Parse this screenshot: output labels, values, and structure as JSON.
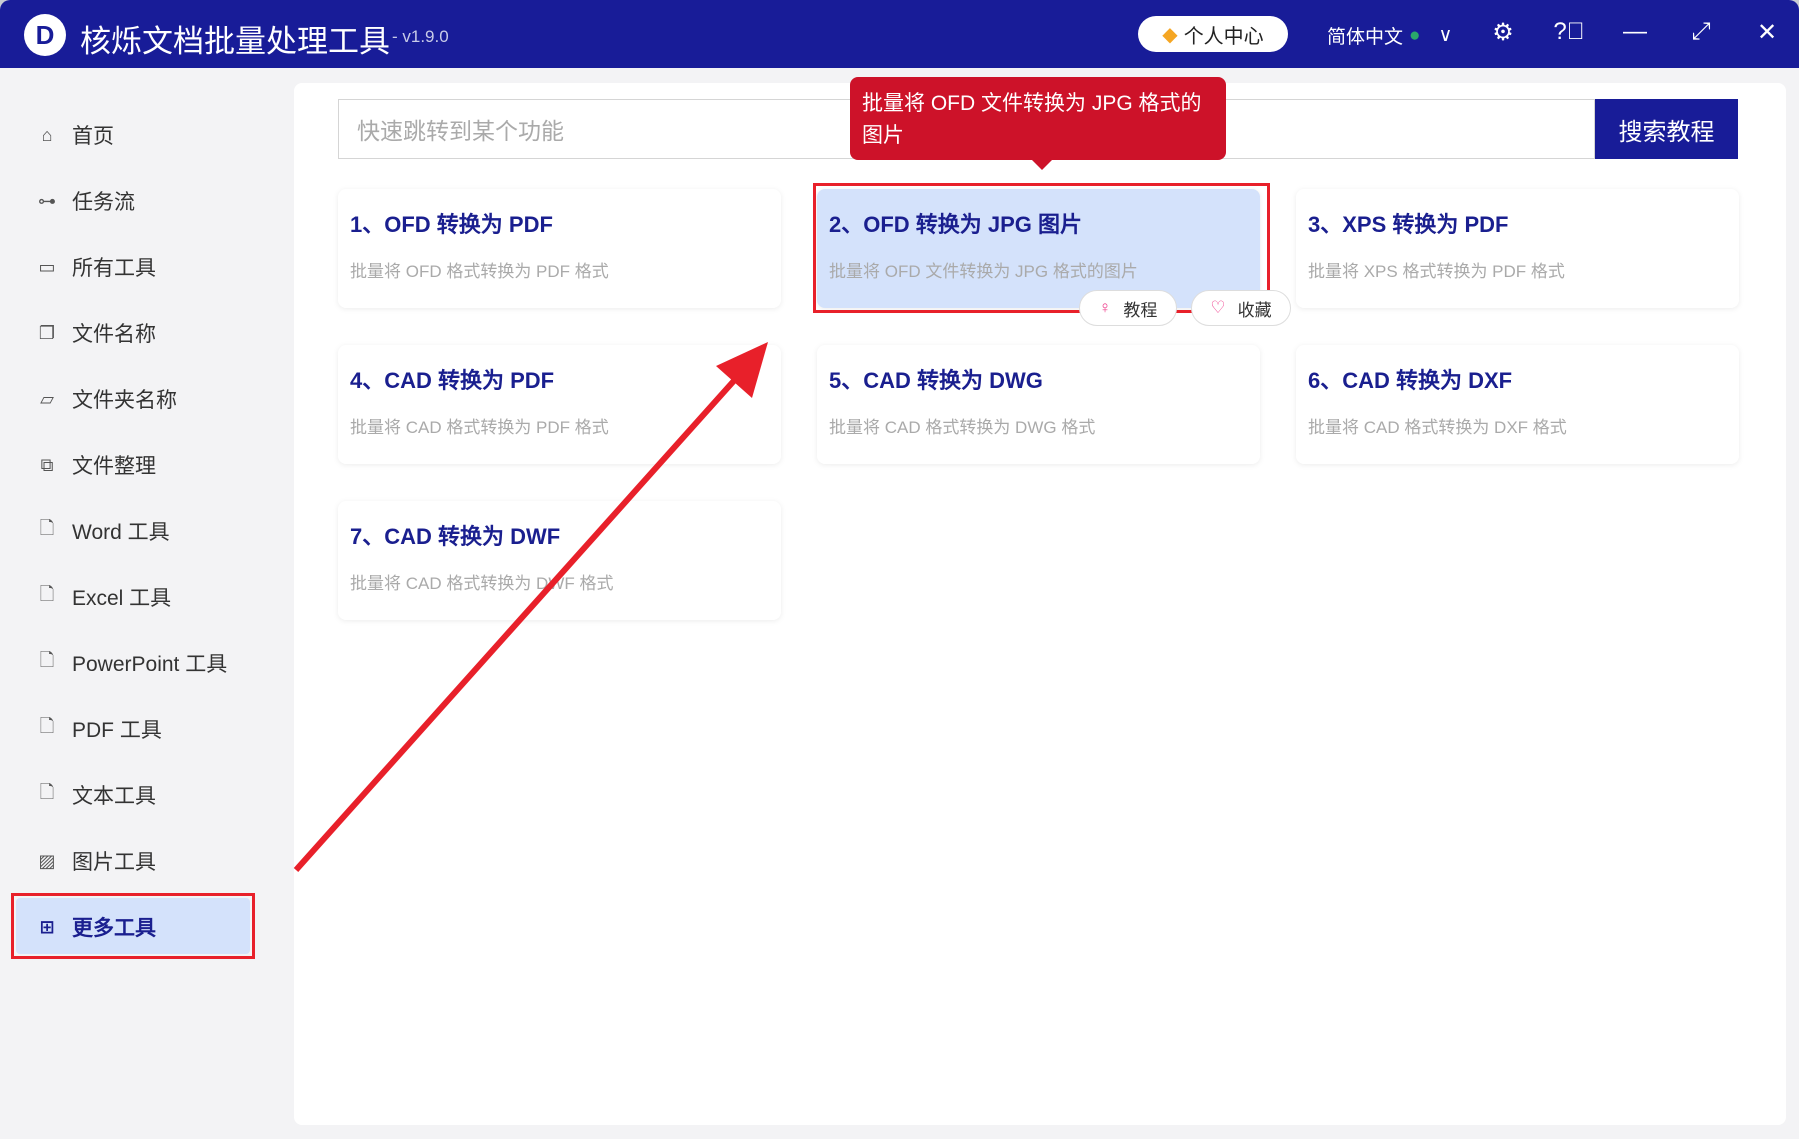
{
  "app": {
    "title": "核烁文档批量处理工具",
    "version": "- v1.9.0",
    "logo": "D"
  },
  "titlebar": {
    "personal_center": "个人中心",
    "language": "简体中文"
  },
  "sidebar": {
    "items": [
      {
        "label": "首页",
        "icon": "home-icon"
      },
      {
        "label": "任务流",
        "icon": "workflow-icon"
      },
      {
        "label": "所有工具",
        "icon": "monitor-icon"
      },
      {
        "label": "文件名称",
        "icon": "file-icon"
      },
      {
        "label": "文件夹名称",
        "icon": "folder-icon"
      },
      {
        "label": "文件整理",
        "icon": "organize-icon"
      },
      {
        "label": "Word 工具",
        "icon": "word-icon"
      },
      {
        "label": "Excel 工具",
        "icon": "excel-icon"
      },
      {
        "label": "PowerPoint 工具",
        "icon": "ppt-icon"
      },
      {
        "label": "PDF 工具",
        "icon": "pdf-icon"
      },
      {
        "label": "文本工具",
        "icon": "text-icon"
      },
      {
        "label": "图片工具",
        "icon": "image-icon"
      },
      {
        "label": "更多工具",
        "icon": "grid-icon",
        "active": true
      }
    ]
  },
  "search": {
    "placeholder": "快速跳转到某个功能",
    "button": "搜索教程"
  },
  "tooltip": "批量将 OFD 文件转换为 JPG 格式的图片",
  "cards": [
    {
      "title": "1、OFD 转换为 PDF",
      "desc": "批量将 OFD 格式转换为 PDF 格式"
    },
    {
      "title": "2、OFD 转换为 JPG 图片",
      "desc": "批量将 OFD 文件转换为 JPG 格式的图片"
    },
    {
      "title": "3、XPS 转换为 PDF",
      "desc": "批量将 XPS 格式转换为 PDF 格式"
    },
    {
      "title": "4、CAD 转换为 PDF",
      "desc": "批量将 CAD 格式转换为 PDF 格式"
    },
    {
      "title": "5、CAD 转换为 DWG",
      "desc": "批量将 CAD 格式转换为 DWG 格式"
    },
    {
      "title": "6、CAD 转换为 DXF",
      "desc": "批量将 CAD 格式转换为 DXF 格式"
    },
    {
      "title": "7、CAD 转换为 DWF",
      "desc": "批量将 CAD 格式转换为 DWF 格式"
    }
  ],
  "card_actions": {
    "tutorial": "教程",
    "favorite": "收藏"
  },
  "colors": {
    "brand": "#181c98",
    "highlight": "#e8202a",
    "tooltip": "#cd1229"
  }
}
